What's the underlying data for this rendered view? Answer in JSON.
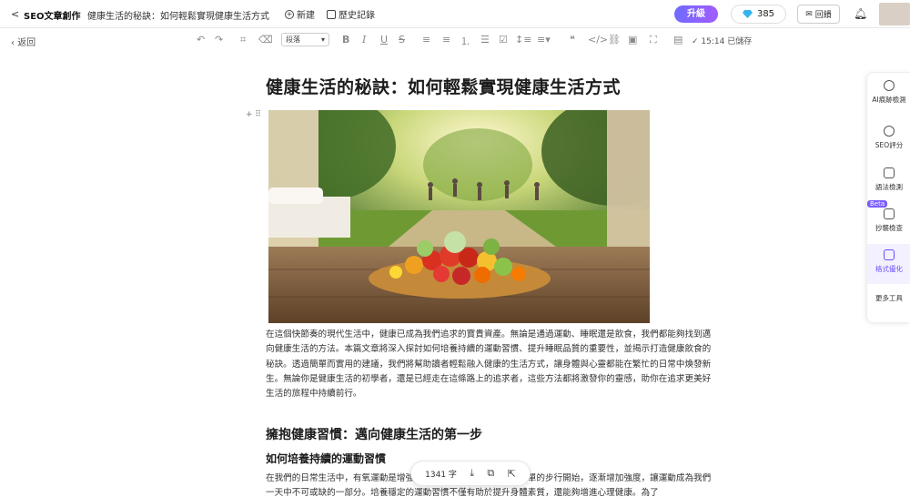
{
  "topbar": {
    "back_label": "<",
    "app_title": "SEO文章創作",
    "doc_title": "健康生活的秘訣：如何輕鬆實現健康生活方式",
    "new_label": "新建",
    "history_label": "歷史記錄",
    "upgrade_label": "升級",
    "gems_count": "385",
    "feedback_label": "回饋"
  },
  "toolbar": {
    "back_label": "返回",
    "paragraph_select": "段落",
    "saved_status": "15:14 已儲存"
  },
  "document": {
    "title": "健康生活的秘訣：如何輕鬆實現健康生活方式",
    "intro": "在這個快節奏的現代生活中，健康已成為我們追求的寶貴資產。無論是通過運動、睡眠還是飲食，我們都能夠找到邁向健康生活的方法。本篇文章將深入探討如何培養持續的運動習慣、提升睡眠品質的重要性，並揭示打造健康飲食的秘訣。透過簡單而實用的建議，我們將幫助讀者輕鬆融入健康的生活方式，讓身體與心靈都能在繁忙的日常中煥發新生。無論你是健康生活的初學者，還是已經走在這條路上的追求者，這些方法都將激發你的靈感，助你在追求更美好生活的旅程中持續前行。",
    "h2": "擁抱健康習慣：邁向健康生活的第一步",
    "h3": "如何培養持續的運動習慣",
    "para2": "在我們的日常生活中，有氧運動是增強心肺功能的好方法。可以從簡單的步行開始，逐漸增加強度，讓運動成為我們一天中不可或缺的一部分。培養穩定的運動習慣不僅有助於提升身體素質，還能夠增進心理健康。為了"
  },
  "floatbar": {
    "word_count": "1341 字"
  },
  "sidepanel": {
    "items": [
      {
        "label": "AI痕跡檢測",
        "icon": "ai-detect-icon"
      },
      {
        "label": "SEO評分",
        "icon": "seo-score-icon"
      },
      {
        "label": "語法檢測",
        "icon": "grammar-icon"
      },
      {
        "label": "抄襲檢查",
        "icon": "plagiarism-icon"
      },
      {
        "label": "格式優化",
        "icon": "format-icon"
      },
      {
        "label": "更多工具",
        "icon": "more-tools-icon"
      }
    ],
    "beta_label": "Beta"
  },
  "colors": {
    "accent": "#6a4cff",
    "upgrade_gradient_start": "#6f6bff",
    "upgrade_gradient_end": "#a25cff",
    "gem": "#36b3f0"
  }
}
